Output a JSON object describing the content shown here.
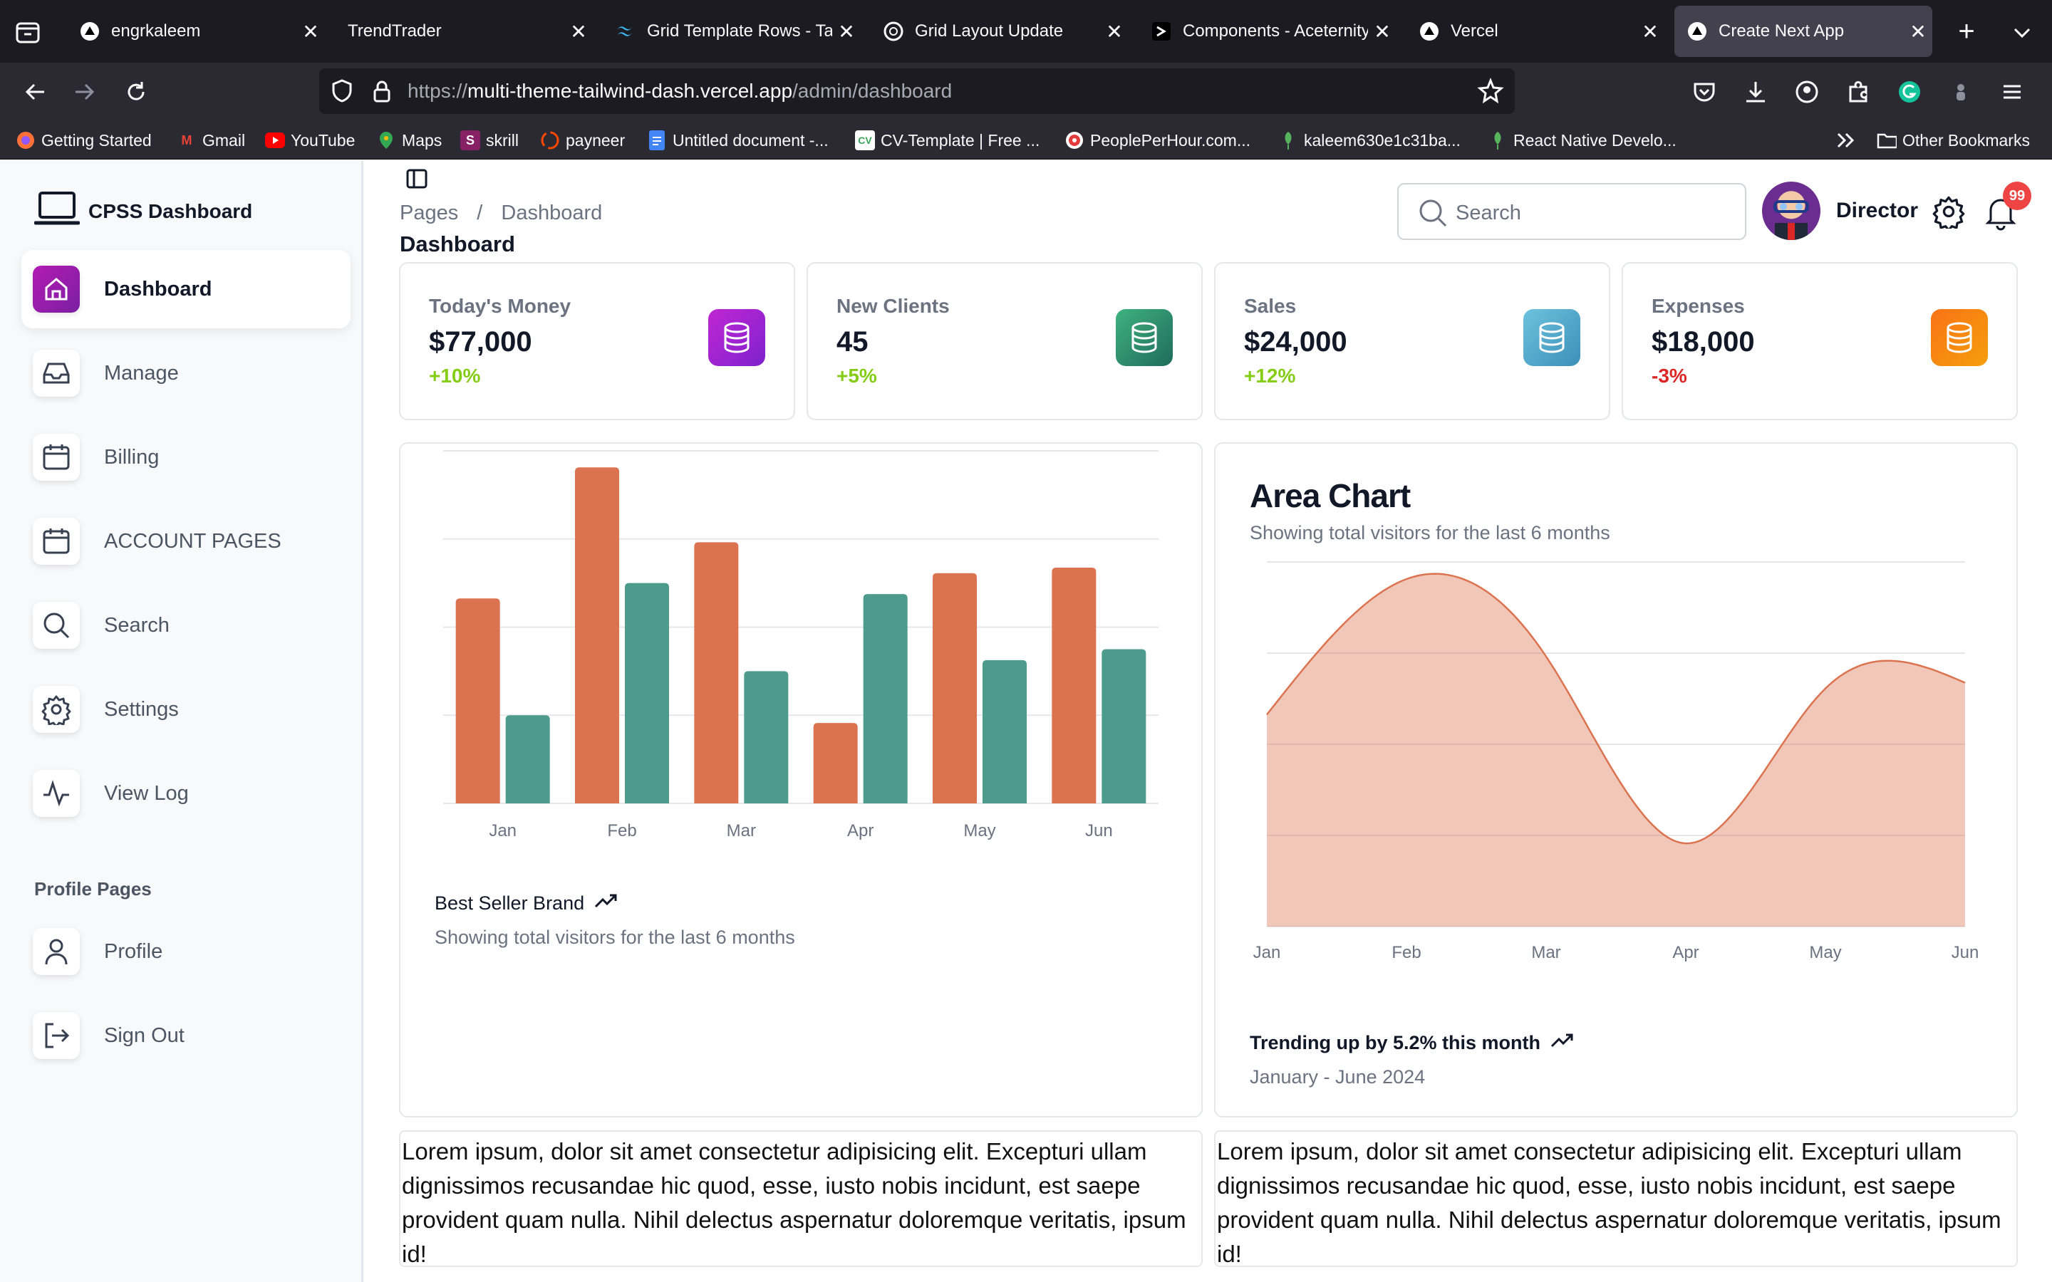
{
  "browser": {
    "tabs": [
      {
        "title": "engrkaleem",
        "icon": "vercel-triangle-icon"
      },
      {
        "title": "TrendTrader",
        "icon": ""
      },
      {
        "title": "Grid Template Rows - Tai",
        "icon": "tailwind-icon"
      },
      {
        "title": "Grid Layout Update",
        "icon": "openai-icon"
      },
      {
        "title": "Components - Aceternity",
        "icon": "aceternity-icon"
      },
      {
        "title": "Vercel",
        "icon": "vercel-triangle-icon"
      },
      {
        "title": "Create Next App",
        "icon": "vercel-triangle-icon"
      }
    ],
    "url_scheme": "https://",
    "url_host": "multi-theme-tailwind-dash.vercel.app",
    "url_path": "/admin/dashboard",
    "bookmarks": [
      "Getting Started",
      "Gmail",
      "YouTube",
      "Maps",
      "skrill",
      "payneer",
      "Untitled document -...",
      "CV-Template | Free ...",
      "PeoplePerHour.com...",
      "kaleem630e1c31ba...",
      "React Native Develo..."
    ],
    "other_bookmarks": "Other Bookmarks"
  },
  "sidebar": {
    "brand": "CPSS Dashboard",
    "items": [
      {
        "label": "Dashboard",
        "icon": "home-icon"
      },
      {
        "label": "Manage",
        "icon": "inbox-icon"
      },
      {
        "label": "Billing",
        "icon": "calendar-icon"
      },
      {
        "label": "ACCOUNT PAGES",
        "icon": "calendar-icon"
      },
      {
        "label": "Search",
        "icon": "search-icon"
      },
      {
        "label": "Settings",
        "icon": "gear-icon"
      },
      {
        "label": "View Log",
        "icon": "activity-icon"
      }
    ],
    "profile_section": "Profile Pages",
    "profile_items": [
      {
        "label": "Profile",
        "icon": "user-icon"
      },
      {
        "label": "Sign Out",
        "icon": "logout-icon"
      }
    ]
  },
  "header": {
    "breadcrumb_root": "Pages",
    "breadcrumb_sep": "/",
    "breadcrumb_current": "Dashboard",
    "title": "Dashboard",
    "search_placeholder": "Search",
    "user_name": "Director",
    "notification_count": "99"
  },
  "stats": [
    {
      "label": "Today's Money",
      "value": "$77,000",
      "change": "+10%",
      "color_from": "#c026d3",
      "color_to": "#7e22ce",
      "change_color": "#84cc16"
    },
    {
      "label": "New Clients",
      "value": "45",
      "change": "+5%",
      "color_from": "#3fb27f",
      "color_to": "#1f6b5c",
      "change_color": "#84cc16"
    },
    {
      "label": "Sales",
      "value": "$24,000",
      "change": "+12%",
      "color_from": "#6dc3de",
      "color_to": "#3c8fb8",
      "change_color": "#84cc16"
    },
    {
      "label": "Expenses",
      "value": "$18,000",
      "change": "-3%",
      "color_from": "#f97316",
      "color_to": "#f59e0b",
      "change_color": "#dc2626"
    }
  ],
  "chart_data": [
    {
      "type": "bar",
      "categories": [
        "Jan",
        "Feb",
        "Mar",
        "Apr",
        "May",
        "Jun"
      ],
      "series": [
        {
          "values": [
            186,
            305,
            237,
            73,
            209,
            214
          ],
          "color": "#dc7350"
        },
        {
          "values": [
            80,
            200,
            120,
            190,
            130,
            140
          ],
          "color": "#4d9b8d"
        }
      ],
      "ylim": [
        0,
        320
      ],
      "grid": true,
      "footer_title": "Best Seller Brand",
      "footer_subtitle": "Showing total visitors for the last 6 months"
    },
    {
      "type": "area",
      "title": "Area Chart",
      "subtitle": "Showing total visitors for the last 6 months",
      "categories": [
        "Jan",
        "Feb",
        "Mar",
        "Apr",
        "May",
        "Jun"
      ],
      "values": [
        186,
        305,
        237,
        73,
        209,
        214
      ],
      "ylim": [
        0,
        320
      ],
      "color": "#dc7350",
      "grid": true,
      "footer_title": "Trending up by 5.2% this month",
      "footer_subtitle": "January - June 2024"
    }
  ],
  "lorem": [
    "Lorem ipsum, dolor sit amet consectetur adipisicing elit. Excepturi ullam dignissimos recusandae hic quod, esse, iusto nobis incidunt, est saepe provident quam nulla. Nihil delectus aspernatur doloremque veritatis, ipsum id!",
    "Lorem ipsum, dolor sit amet consectetur adipisicing elit. Excepturi ullam dignissimos recusandae hic quod, esse, iusto nobis incidunt, est saepe provident quam nulla. Nihil delectus aspernatur doloremque veritatis, ipsum id!"
  ]
}
